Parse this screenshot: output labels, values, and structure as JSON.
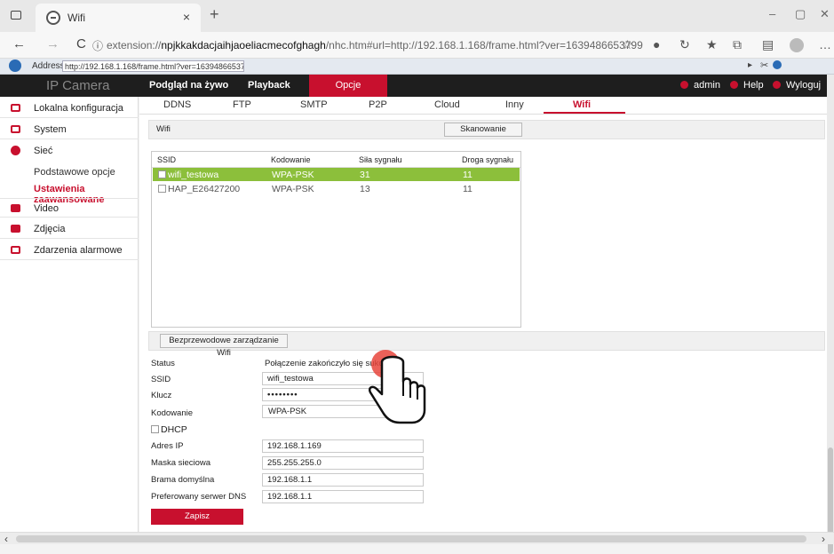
{
  "browser": {
    "tab_title": "Wifi",
    "tab_close": "×",
    "new_tab": "+",
    "url_prefix": "extension://",
    "url_host": "npjkkakdacjaihjaoeliacmecofghagh",
    "url_rest": "/nhc.htm#url=http://192.168.1.168/frame.html?ver=1639486653799",
    "ie_label": "Address",
    "ie_address": "http://192.168.1.168/frame.html?ver=1639486653799",
    "window_controls": [
      "–",
      "▢",
      "✕"
    ],
    "nav": {
      "back": "←",
      "forward": "→",
      "refresh": "C",
      "info": "ⓘ"
    }
  },
  "camera_header": {
    "brand": "IP Camera",
    "tabs": [
      "Podgląd na żywo",
      "Playback",
      "Opcje"
    ],
    "active_tab": "Opcje",
    "right_items": [
      "admin",
      "Help",
      "Wyloguj"
    ]
  },
  "sidebar": {
    "items": [
      {
        "label": "Lokalna konfiguracja",
        "icon": "monitor-icon"
      },
      {
        "label": "System",
        "icon": "system-icon"
      },
      {
        "label": "Sieć",
        "icon": "network-icon"
      },
      {
        "label": "Video",
        "icon": "video-icon"
      },
      {
        "label": "Zdjęcia",
        "icon": "image-icon"
      },
      {
        "label": "Zdarzenia alarmowe",
        "icon": "alarm-icon"
      }
    ],
    "network_sub": [
      {
        "label": "Podstawowe opcje",
        "active": false
      },
      {
        "label": "Ustawienia zaawansowane",
        "active": true
      }
    ]
  },
  "subtabs": {
    "items": [
      "DDNS",
      "FTP",
      "SMTP",
      "P2P",
      "Cloud",
      "Inny",
      "Wifi"
    ],
    "active": "Wifi"
  },
  "wifi": {
    "section_label": "Wifi",
    "scan_button": "Skanowanie",
    "table": {
      "headers": [
        "SSID",
        "Kodowanie",
        "Siła sygnału",
        "Droga sygnału"
      ],
      "rows": [
        {
          "ssid": "wifi_testowa",
          "encoding": "WPA-PSK",
          "signal": "31",
          "channel": "11",
          "selected": true
        },
        {
          "ssid": "HAP_E26427200",
          "encoding": "WPA-PSK",
          "signal": "13",
          "channel": "11",
          "selected": false
        }
      ]
    },
    "manage_button": "Bezprzewodowe zarządzanie Wifi",
    "form": {
      "status_label": "Status",
      "status_value": "Połączenie zakończyło się sukcesem",
      "ssid_label": "SSID",
      "ssid_value": "wifi_testowa",
      "key_label": "Klucz",
      "key_value": "••••••••",
      "encoding_label": "Kodowanie",
      "encoding_value": "WPA-PSK",
      "dhcp_label": "DHCP",
      "ip_label": "Adres IP",
      "ip_value": "192.168.1.169",
      "mask_label": "Maska sieciowa",
      "mask_value": "255.255.255.0",
      "gateway_label": "Brama domyślna",
      "gateway_value": "192.168.1.1",
      "dns_label": "Preferowany serwer DNS",
      "dns_value": "192.168.1.1",
      "save_button": "Zapisz"
    }
  },
  "colors": {
    "accent": "#c8102e",
    "selected_row": "#8cbf3b",
    "header_bg": "#1e1e1e"
  }
}
